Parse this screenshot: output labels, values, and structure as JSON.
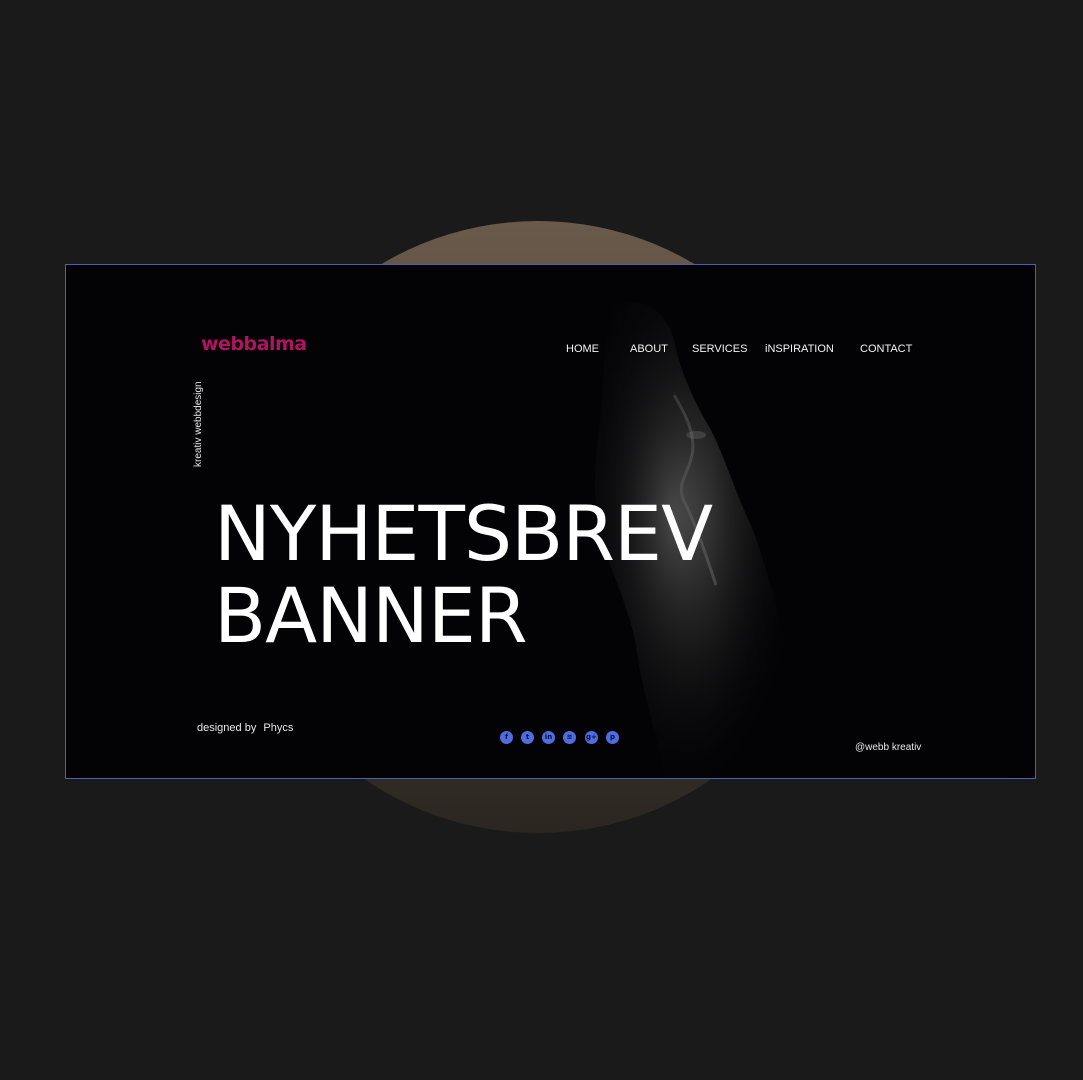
{
  "brand": {
    "logo": "webbalma",
    "tagline": "kreativ webbdesign",
    "logo_color": "#b0145f"
  },
  "nav": {
    "items": [
      {
        "label": "HOME"
      },
      {
        "label": "ABOUT"
      },
      {
        "label": "SERVICES"
      },
      {
        "label": "iNSPIRATION"
      },
      {
        "label": "CONTACT"
      }
    ]
  },
  "hero": {
    "line1": "NYHETSBREV",
    "line2": "BANNER"
  },
  "footer": {
    "credit_prefix": "designed by",
    "credit_author": "Phycs",
    "handle": "@webb kreativ",
    "social_icons": [
      {
        "name": "facebook-icon",
        "glyph": "f"
      },
      {
        "name": "twitter-icon",
        "glyph": "t"
      },
      {
        "name": "linkedin-icon",
        "glyph": "in"
      },
      {
        "name": "rss-icon",
        "glyph": "≋"
      },
      {
        "name": "google-plus-icon",
        "glyph": "g+"
      },
      {
        "name": "pinterest-icon",
        "glyph": "p"
      }
    ],
    "social_color": "#4f6de0"
  },
  "theme": {
    "page_bg": "#1a1a1a",
    "banner_bg": "#030305",
    "banner_border": "#4a5fb8",
    "circle_color": "#6a5a4b"
  }
}
